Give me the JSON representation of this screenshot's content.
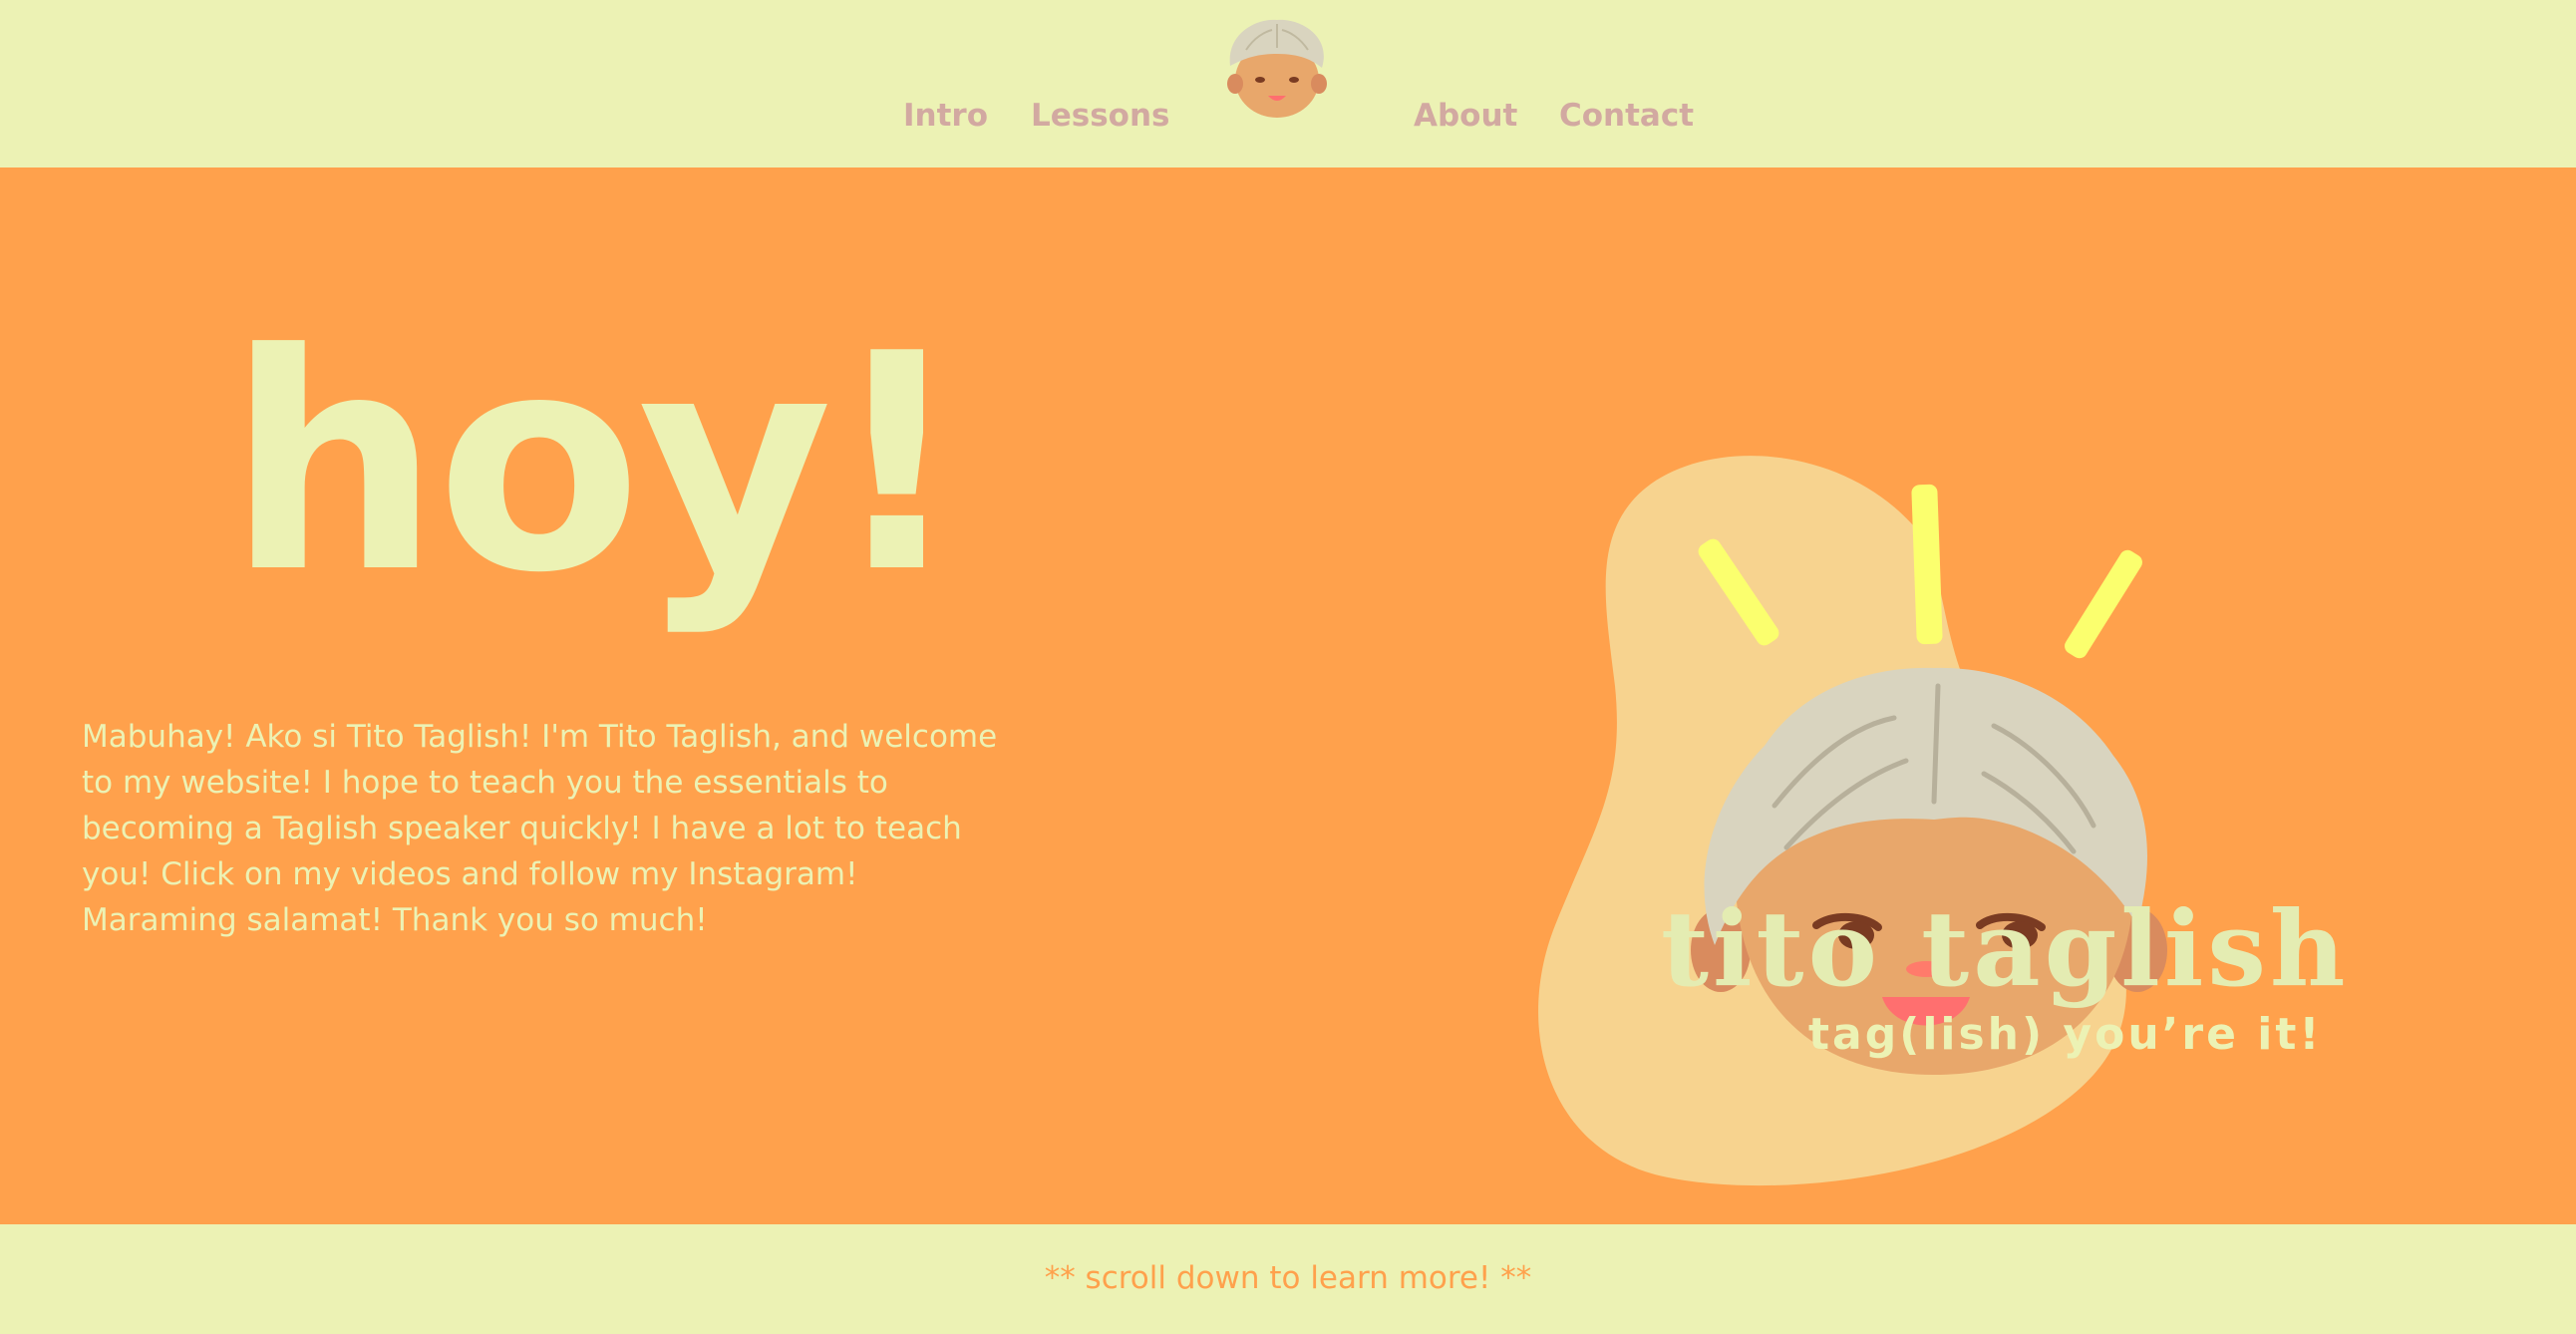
{
  "nav": {
    "links": [
      {
        "label": "Intro"
      },
      {
        "label": "Lessons"
      },
      {
        "label": "About"
      },
      {
        "label": "Contact"
      }
    ],
    "logo_icon": "grandpa-face-icon"
  },
  "hero": {
    "title": "hoy!",
    "intro_text": "Mabuhay! Ako si Tito Taglish! I'm Tito Taglish, and welcome to my website! I hope to teach you the essentials to becoming a Taglish speaker quickly! I have a lot to teach you! Click on my videos and follow my Instagram! Maraming salamat! Thank you so much!",
    "brand_name": "tito taglish",
    "brand_tagline": "tag(lish) you’re it!",
    "art_icon": "tito-taglish-mascot-icon"
  },
  "footer": {
    "scroll_hint": "** scroll down to learn more! **"
  },
  "colors": {
    "cream": "#ecf2b4",
    "orange": "#ffa14c",
    "nav_text": "#d2a9a1",
    "blob": "#f7d38f",
    "hair": "#d9d4bf",
    "skin": "#e8a76b",
    "ray": "#fbff6e"
  }
}
